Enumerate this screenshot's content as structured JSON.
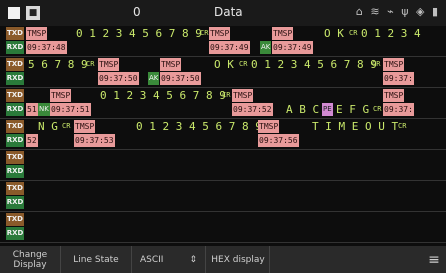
{
  "topbar": {
    "badge": "■",
    "count": "0",
    "title": "Data",
    "icons": "⌂ ≋ ⌁ ψ ◈ ▮"
  },
  "tags": {
    "txd": "TXD",
    "rxd": "RXD"
  },
  "rows": [
    {
      "txd": [
        {
          "kind": "ts",
          "label": "TMSP"
        },
        {
          "kind": "text",
          "text": "0 1 2 3 4 5 6 7 8 9"
        },
        {
          "kind": "cr",
          "text": "CR"
        },
        {
          "kind": "ts",
          "label": "TMSP"
        },
        {
          "kind": "ts",
          "label": "TMSP"
        },
        {
          "kind": "text",
          "text": "O K"
        },
        {
          "kind": "cr",
          "text": "CR"
        },
        {
          "kind": "text",
          "text": "0 1 2 3 4"
        }
      ],
      "rxd": [
        {
          "kind": "ts",
          "label": "09:37:48"
        },
        {
          "kind": "ts",
          "label": "09:37:49"
        },
        {
          "kind": "ak",
          "text": "AK"
        },
        {
          "kind": "ts",
          "label": "09:37:49"
        }
      ]
    },
    {
      "txd": [
        {
          "kind": "text",
          "text": "5 6 7 8 9"
        },
        {
          "kind": "cr",
          "text": "CR"
        },
        {
          "kind": "ts",
          "label": "TMSP"
        },
        {
          "kind": "ts",
          "label": "TMSP"
        },
        {
          "kind": "text",
          "text": "O K"
        },
        {
          "kind": "cr",
          "text": "CR"
        },
        {
          "kind": "text",
          "text": "0 1 2 3 4 5 6 7 8 9"
        },
        {
          "kind": "cr",
          "text": "CR"
        },
        {
          "kind": "ts",
          "label": "TMSP"
        }
      ],
      "rxd": [
        {
          "kind": "ts",
          "label": "09:37:50"
        },
        {
          "kind": "ak",
          "text": "AK"
        },
        {
          "kind": "ts",
          "label": "09:37:50"
        },
        {
          "kind": "ts",
          "label": "09:37:"
        }
      ]
    },
    {
      "txd": [
        {
          "kind": "ts",
          "label": "TMSP"
        },
        {
          "kind": "text",
          "text": "0 1 2 3 4 5 6 7 8 9"
        },
        {
          "kind": "cr",
          "text": "CR"
        },
        {
          "kind": "ts",
          "label": "TMSP"
        },
        {
          "kind": "ts",
          "label": "TMSP"
        }
      ],
      "rxd": [
        {
          "kind": "ts",
          "label": "51"
        },
        {
          "kind": "ak",
          "text": "NK"
        },
        {
          "kind": "ts",
          "label": "09:37:51"
        },
        {
          "kind": "ts",
          "label": "09:37:52"
        },
        {
          "kind": "text",
          "text": "A B C"
        },
        {
          "kind": "pe",
          "text": "PE"
        },
        {
          "kind": "text",
          "text": "E F G"
        },
        {
          "kind": "cr",
          "text": "CR"
        },
        {
          "kind": "ts",
          "label": "09:37:"
        }
      ]
    },
    {
      "txd": [
        {
          "kind": "text",
          "text": "N G"
        },
        {
          "kind": "cr",
          "text": "CR"
        },
        {
          "kind": "ts",
          "label": "TMSP"
        },
        {
          "kind": "text",
          "text": "0 1 2 3 4 5 6 7 8 9"
        },
        {
          "kind": "cr",
          "text": "CR"
        },
        {
          "kind": "ts",
          "label": "TMSP"
        },
        {
          "kind": "text",
          "text": "T I M E O U T"
        },
        {
          "kind": "cr",
          "text": "CR"
        }
      ],
      "rxd": [
        {
          "kind": "ts",
          "label": "52"
        },
        {
          "kind": "ts",
          "label": "09:37:53"
        },
        {
          "kind": "ts",
          "label": "09:37:56"
        }
      ]
    }
  ],
  "toolbar": {
    "change_display": "Change\nDisplay",
    "line_state": "Line State",
    "ascii": "ASCII",
    "ascii_arrow": "⇕",
    "hex_display": "HEX display",
    "menu_icon": "≡"
  }
}
